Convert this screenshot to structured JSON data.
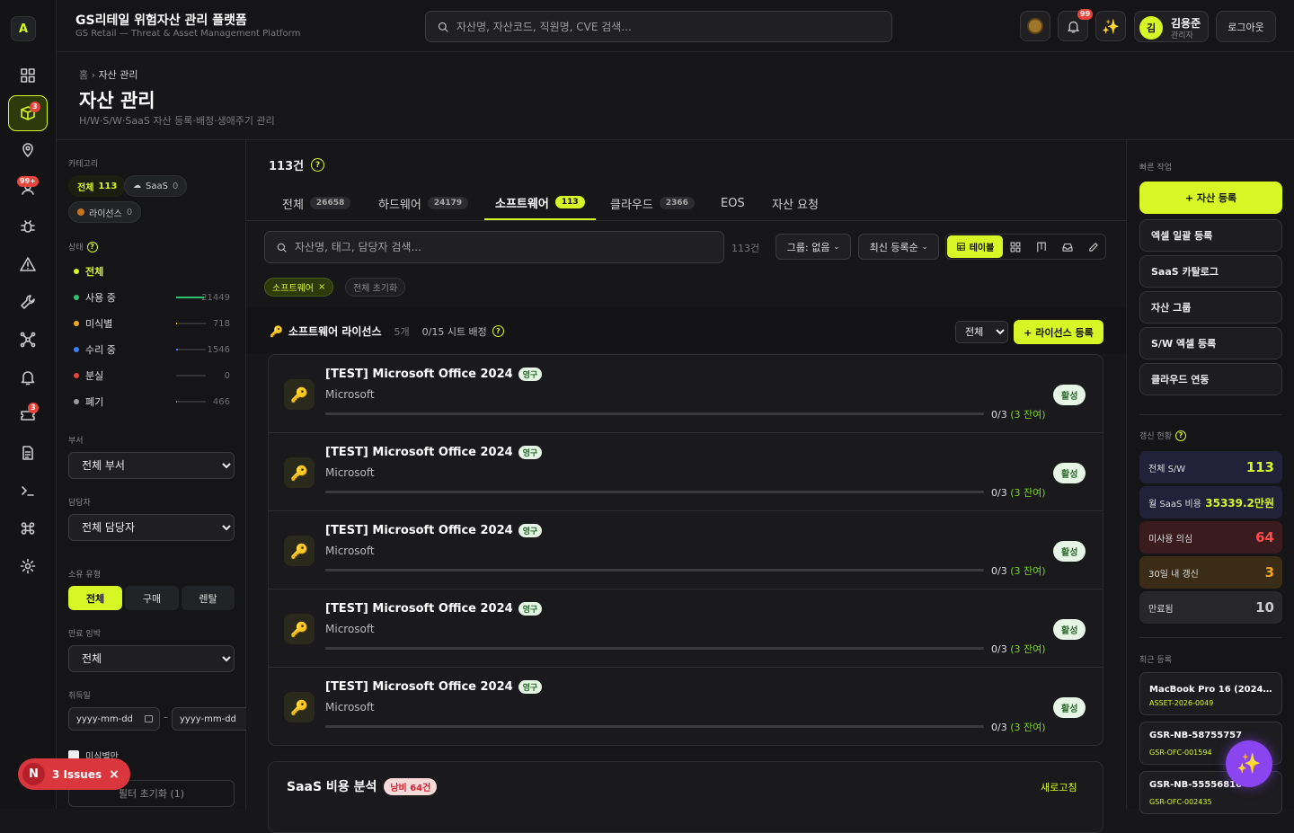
{
  "header": {
    "title": "GS리테일 위험자산 관리 플랫폼",
    "subtitle": "GS Retail — Threat & Asset Management Platform",
    "search_placeholder": "자산명, 자산코드, 직원명, CVE 검색...",
    "notif_count": "99",
    "user_initial": "김",
    "user_name": "김용준",
    "user_role": "관리자",
    "logout": "로그아웃"
  },
  "rail": {
    "logo": "A",
    "badges": {
      "assets": "3",
      "security": "99+",
      "tickets": "3"
    }
  },
  "page": {
    "breadcrumb_home": "홈",
    "breadcrumb_sep": "›",
    "breadcrumb_current": "자산 관리",
    "title": "자산 관리",
    "subtitle": "H/W·S/W·SaaS 자산 등록·배정·생애주기 관리"
  },
  "filters": {
    "category_label": "카테고리",
    "chips": [
      {
        "label": "전체",
        "count": "113"
      },
      {
        "label": "SaaS",
        "count": "0"
      },
      {
        "label": "라이선스",
        "count": "0"
      }
    ],
    "status_label": "상태",
    "statuses": [
      {
        "label": "전체",
        "count": "",
        "color": "#d7f626",
        "fill": 0
      },
      {
        "label": "사용 중",
        "count": "21449",
        "color": "#2fbf71",
        "fill": 0.95
      },
      {
        "label": "미식별",
        "count": "718",
        "color": "#f5a623",
        "fill": 0.03
      },
      {
        "label": "수리 중",
        "count": "1546",
        "color": "#3b82f6",
        "fill": 0.07
      },
      {
        "label": "분실",
        "count": "0",
        "color": "#e5453c",
        "fill": 0
      },
      {
        "label": "폐기",
        "count": "466",
        "color": "#9a9aa0",
        "fill": 0.02
      }
    ],
    "dept_label": "부서",
    "dept_value": "전체 부서",
    "owner_label": "담당자",
    "owner_value": "전체 담당자",
    "ownership_label": "소유 유형",
    "ownership": [
      "전체",
      "구매",
      "렌탈"
    ],
    "expiry_label": "만료 임박",
    "expiry_value": "전체",
    "acq_label": "취득일",
    "date_placeholder": "yyyy-mm-dd",
    "date_sep": "–",
    "unid_label": "미식별만",
    "reset": "필터 초기화 (1)"
  },
  "main": {
    "count": "113건",
    "tabs": [
      {
        "label": "전체",
        "count": "26658"
      },
      {
        "label": "하드웨어",
        "count": "24179"
      },
      {
        "label": "소프트웨어",
        "count": "113"
      },
      {
        "label": "클라우드",
        "count": "2366"
      },
      {
        "label": "EOS",
        "count": ""
      },
      {
        "label": "자산 요청",
        "count": ""
      }
    ],
    "search_placeholder": "자산명, 태그, 담당자 검색...",
    "result_count": "113건",
    "group_btn": "그룹: 없음",
    "sort_btn": "최신 등록순",
    "view_table": "테이블",
    "active_filter": "소프트웨어",
    "reset_all": "전체 초기화"
  },
  "licenses": {
    "title": "소프트웨어 라이선스",
    "count": "5개",
    "seats": "0/15 시트 배정",
    "scope": "전체",
    "add_btn": "+ 라이선스 등록",
    "items": [
      {
        "name": "[TEST] Microsoft Office 2024",
        "type": "영구",
        "vendor": "Microsoft",
        "used": "0/3",
        "remain": "(3 잔여)",
        "status": "활성",
        "usage": 0
      },
      {
        "name": "[TEST] Microsoft Office 2024",
        "type": "영구",
        "vendor": "Microsoft",
        "used": "0/3",
        "remain": "(3 잔여)",
        "status": "활성",
        "usage": 0
      },
      {
        "name": "[TEST] Microsoft Office 2024",
        "type": "영구",
        "vendor": "Microsoft",
        "used": "0/3",
        "remain": "(3 잔여)",
        "status": "활성",
        "usage": 0
      },
      {
        "name": "[TEST] Microsoft Office 2024",
        "type": "영구",
        "vendor": "Microsoft",
        "used": "0/3",
        "remain": "(3 잔여)",
        "status": "활성",
        "usage": 0
      },
      {
        "name": "[TEST] Microsoft Office 2024",
        "type": "영구",
        "vendor": "Microsoft",
        "used": "0/3",
        "remain": "(3 잔여)",
        "status": "활성",
        "usage": 0
      }
    ]
  },
  "saas": {
    "title": "SaaS 비용 분석",
    "waste": "낭비 64건",
    "refresh": "새로고침"
  },
  "right": {
    "quick_label": "빠른 작업",
    "quick": [
      "+ 자산 등록",
      "엑셀 일괄 등록",
      "SaaS 카탈로그",
      "자산 그룹",
      "S/W 엑셀 등록",
      "클라우드 연동"
    ],
    "renew_label": "갱신 현황",
    "stats": [
      {
        "label": "전체 S/W",
        "value": "113",
        "color": "#d7f626",
        "bg": "#22213a"
      },
      {
        "label": "월 SaaS 비용",
        "value": "35339.2만원",
        "color": "#d7f626",
        "bg": "#22213a"
      },
      {
        "label": "미사용 의심",
        "value": "64",
        "color": "#ff4d4d",
        "bg": "#3a1c1e"
      },
      {
        "label": "30일 내 갱신",
        "value": "3",
        "color": "#f5a623",
        "bg": "#3a2c16"
      },
      {
        "label": "만료됨",
        "value": "10",
        "color": "#c9c9cf",
        "bg": "#26262b"
      }
    ],
    "recent_label": "최근 등록",
    "recent": [
      {
        "name": "MacBook Pro 16 (2024년...",
        "code": "ASSET-2026-0049"
      },
      {
        "name": "GSR-NB-58755757",
        "code": "GSR-OFC-001594"
      },
      {
        "name": "GSR-NB-55556810",
        "code": "GSR-OFC-002435"
      }
    ]
  },
  "issues": {
    "initial": "N",
    "label": "3 Issues"
  }
}
